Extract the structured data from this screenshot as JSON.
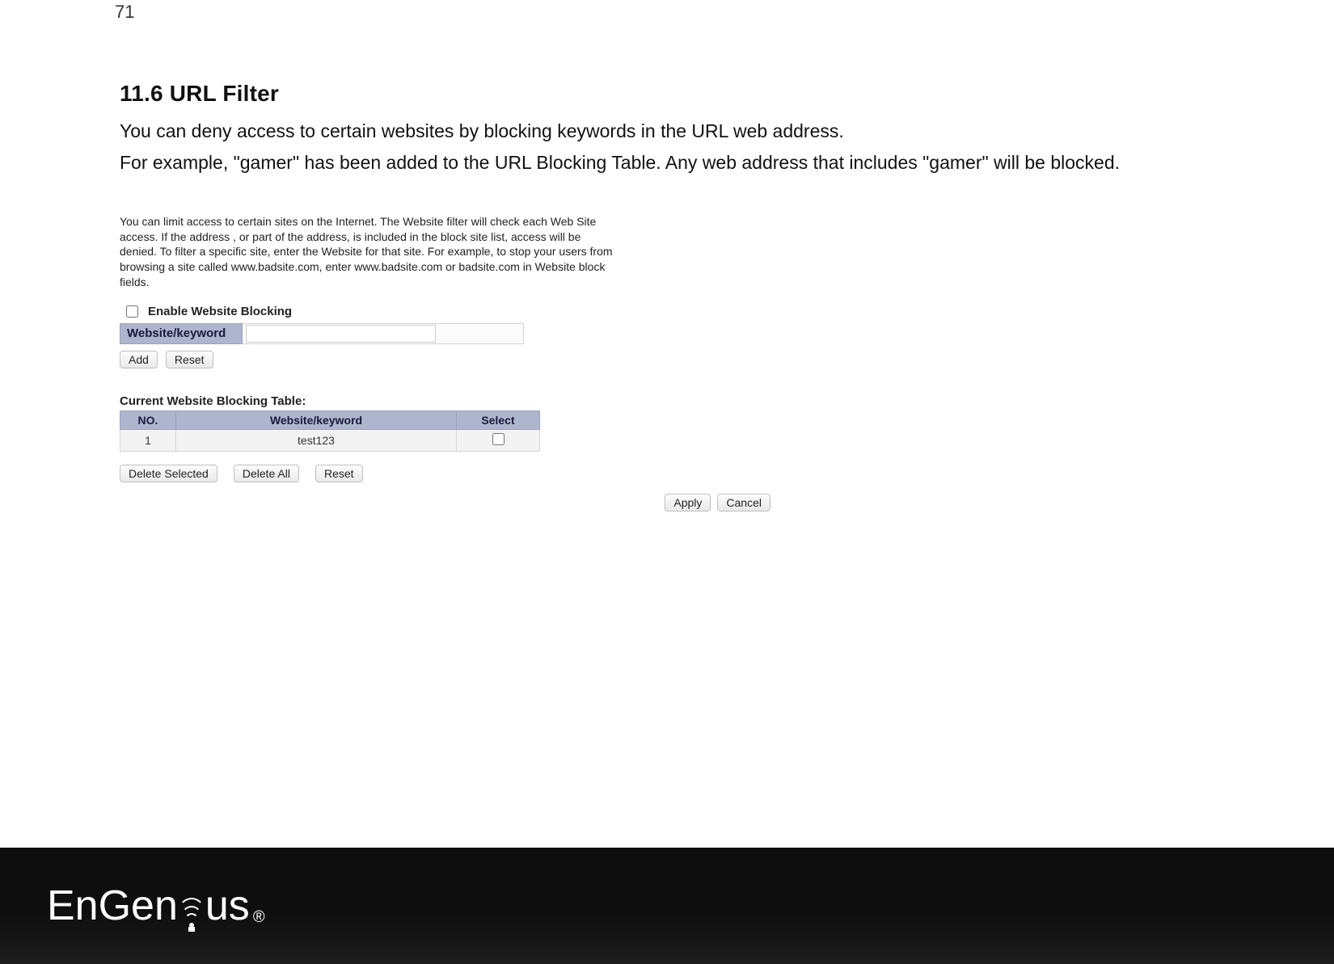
{
  "page_number": "71",
  "section": {
    "heading": "11.6   URL Filter",
    "para1": "You can deny access to certain websites by blocking keywords in the URL web address.",
    "para2": "For example, \"gamer\" has been added to the URL Blocking Table. Any web address that includes \"gamer\" will be blocked."
  },
  "ui": {
    "description": "You can limit access to certain sites on the Internet. The Website filter will check each Web Site access. If the address , or part of the address, is included in the block site list, access will be denied. To filter a specific site, enter the Website for that site. For example, to stop your users from browsing a site called www.badsite.com, enter www.badsite.com or badsite.com in Website block fields.",
    "enable_label": "Enable Website Blocking",
    "keyword_label": "Website/keyword",
    "keyword_value": "",
    "buttons": {
      "add": "Add",
      "reset": "Reset",
      "delete_selected": "Delete Selected",
      "delete_all": "Delete All",
      "reset2": "Reset",
      "apply": "Apply",
      "cancel": "Cancel"
    },
    "table": {
      "title": "Current Website Blocking Table:",
      "headers": {
        "no": "NO.",
        "keyword": "Website/keyword",
        "select": "Select"
      },
      "rows": [
        {
          "no": "1",
          "keyword": "test123",
          "selected": false
        }
      ]
    }
  },
  "footer": {
    "brand": "EnGenius",
    "registered": "®"
  }
}
